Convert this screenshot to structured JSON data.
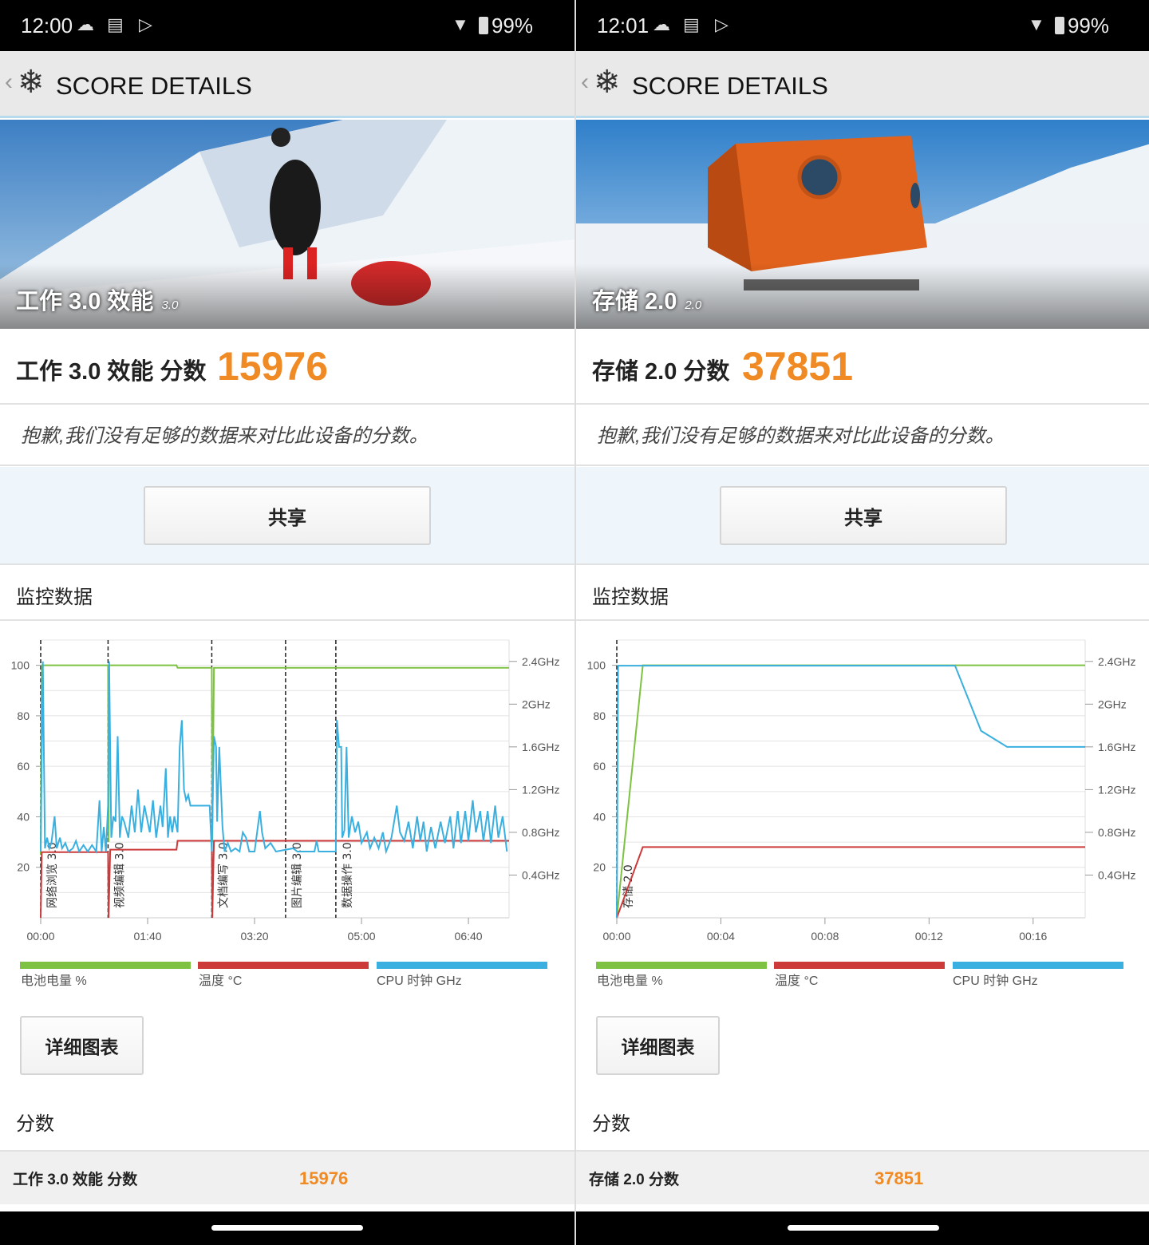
{
  "panels": [
    {
      "status": {
        "time": "12:00",
        "battery": "99%"
      },
      "header": {
        "title": "SCORE DETAILS"
      },
      "hero": {
        "caption": "工作 3.0 效能",
        "version": "3.0"
      },
      "score": {
        "label": "工作 3.0 效能 分数",
        "value": "15976"
      },
      "apology": "抱歉,我们没有足够的数据来对比此设备的分数。",
      "share_label": "共享",
      "monitor_title": "监控数据",
      "legend": [
        "电池电量 %",
        "温度 °C",
        "CPU 时钟 GHz"
      ],
      "detail_label": "详细图表",
      "scores_heading": "分数",
      "score_row": {
        "label": "工作 3.0 效能 分数",
        "value": "15976"
      }
    },
    {
      "status": {
        "time": "12:01",
        "battery": "99%"
      },
      "header": {
        "title": "SCORE DETAILS"
      },
      "hero": {
        "caption": "存储 2.0",
        "version": "2.0"
      },
      "score": {
        "label": "存储 2.0 分数",
        "value": "37851"
      },
      "apology": "抱歉,我们没有足够的数据来对比此设备的分数。",
      "share_label": "共享",
      "monitor_title": "监控数据",
      "legend": [
        "电池电量 %",
        "温度 °C",
        "CPU 时钟 GHz"
      ],
      "detail_label": "详细图表",
      "scores_heading": "分数",
      "score_row": {
        "label": "存储 2.0 分数",
        "value": "37851"
      }
    }
  ],
  "colors": {
    "battery": "#7dc242",
    "temp": "#cc3a3a",
    "cpu": "#3ab0e0",
    "accent": "#f08a24"
  },
  "chart_data": [
    {
      "type": "line",
      "xlim": [
        0,
        438
      ],
      "ylim": [
        0,
        110
      ],
      "y2lim": [
        0,
        2.6
      ],
      "xticks": [
        [
          0,
          "00:00"
        ],
        [
          100,
          "01:40"
        ],
        [
          200,
          "03:20"
        ],
        [
          300,
          "05:00"
        ],
        [
          400,
          "06:40"
        ]
      ],
      "yticks": [
        20,
        40,
        60,
        80,
        100
      ],
      "y2ticks": [
        [
          0.4,
          "0.4GHz"
        ],
        [
          0.8,
          "0.8GHz"
        ],
        [
          1.2,
          "1.2GHz"
        ],
        [
          1.6,
          "1.6GHz"
        ],
        [
          2.0,
          "2GHz"
        ],
        [
          2.4,
          "2.4GHz"
        ]
      ],
      "markers": [
        [
          0,
          "网络浏览 3.0"
        ],
        [
          63,
          "视频编辑 3.0"
        ],
        [
          160,
          "文档编写 3.0"
        ],
        [
          229,
          "图片编辑 3.0"
        ],
        [
          276,
          "数据操作 3.0"
        ]
      ],
      "series": [
        {
          "name": "电池电量 %",
          "axis": "left",
          "color": "#7dc242",
          "points": [
            [
              0,
              25
            ],
            [
              1,
              100
            ],
            [
              63,
              100
            ],
            [
              63.5,
              30
            ],
            [
              64,
              100
            ],
            [
              127,
              100
            ],
            [
              128,
              99
            ],
            [
              160,
              99
            ],
            [
              160.5,
              30
            ],
            [
              162,
              99
            ],
            [
              438,
              99
            ]
          ]
        },
        {
          "name": "温度 °C",
          "axis": "left",
          "color": "#cc3a3a",
          "points": [
            [
              0,
              0
            ],
            [
              1,
              26
            ],
            [
              63,
              26
            ],
            [
              63.5,
              0
            ],
            [
              65,
              27
            ],
            [
              127,
              27
            ],
            [
              128,
              30.5
            ],
            [
              160,
              30.5
            ],
            [
              160.5,
              0
            ],
            [
              162,
              30.5
            ],
            [
              438,
              30.5
            ]
          ]
        },
        {
          "name": "CPU 时钟 GHz",
          "axis": "right",
          "color": "#3ab0e0",
          "points": [
            [
              0,
              0.62
            ],
            [
              2,
              2.4
            ],
            [
              4,
              0.65
            ],
            [
              6,
              0.75
            ],
            [
              8,
              0.65
            ],
            [
              10,
              0.7
            ],
            [
              13,
              0.95
            ],
            [
              15,
              0.65
            ],
            [
              18,
              0.75
            ],
            [
              20,
              0.65
            ],
            [
              23,
              0.7
            ],
            [
              26,
              0.62
            ],
            [
              30,
              0.65
            ],
            [
              33,
              0.72
            ],
            [
              36,
              0.62
            ],
            [
              40,
              0.68
            ],
            [
              44,
              0.62
            ],
            [
              48,
              0.68
            ],
            [
              52,
              0.62
            ],
            [
              55,
              1.1
            ],
            [
              57,
              0.62
            ],
            [
              59,
              0.85
            ],
            [
              61,
              0.62
            ],
            [
              63,
              1.05
            ],
            [
              64,
              2.4
            ],
            [
              66,
              0.75
            ],
            [
              68,
              0.95
            ],
            [
              70,
              0.9
            ],
            [
              72,
              1.7
            ],
            [
              74,
              0.75
            ],
            [
              76,
              0.95
            ],
            [
              78,
              0.9
            ],
            [
              82,
              0.75
            ],
            [
              85,
              1.05
            ],
            [
              88,
              0.8
            ],
            [
              91,
              1.2
            ],
            [
              94,
              0.8
            ],
            [
              97,
              1.05
            ],
            [
              99,
              0.95
            ],
            [
              102,
              0.8
            ],
            [
              105,
              1.1
            ],
            [
              108,
              0.75
            ],
            [
              112,
              1.05
            ],
            [
              114,
              0.85
            ],
            [
              117,
              1.4
            ],
            [
              119,
              0.75
            ],
            [
              121,
              0.95
            ],
            [
              123,
              0.8
            ],
            [
              125,
              0.95
            ],
            [
              128,
              0.8
            ],
            [
              130,
              1.6
            ],
            [
              132,
              1.85
            ],
            [
              134,
              1.2
            ],
            [
              136,
              1.1
            ],
            [
              138,
              1.15
            ],
            [
              140,
              1.05
            ],
            [
              146,
              1.05
            ],
            [
              158,
              1.05
            ],
            [
              160,
              0.62
            ],
            [
              162,
              1.7
            ],
            [
              164,
              1.6
            ],
            [
              165,
              0.9
            ],
            [
              167,
              1.6
            ],
            [
              170,
              0.85
            ],
            [
              172,
              0.62
            ],
            [
              175,
              0.7
            ],
            [
              178,
              0.62
            ],
            [
              182,
              0.65
            ],
            [
              186,
              0.62
            ],
            [
              189,
              0.8
            ],
            [
              192,
              0.75
            ],
            [
              195,
              0.62
            ],
            [
              200,
              0.62
            ],
            [
              205,
              1.0
            ],
            [
              207,
              0.8
            ],
            [
              210,
              0.65
            ],
            [
              215,
              0.7
            ],
            [
              220,
              0.62
            ],
            [
              236,
              0.65
            ],
            [
              240,
              0.62
            ],
            [
              256,
              0.62
            ],
            [
              258,
              0.72
            ],
            [
              260,
              0.62
            ],
            [
              276,
              0.62
            ],
            [
              277,
              1.85
            ],
            [
              279,
              1.6
            ],
            [
              281,
              1.6
            ],
            [
              282,
              0.75
            ],
            [
              284,
              0.82
            ],
            [
              286,
              1.6
            ],
            [
              288,
              0.75
            ],
            [
              291,
              0.95
            ],
            [
              294,
              0.8
            ],
            [
              297,
              0.9
            ],
            [
              300,
              0.7
            ],
            [
              305,
              0.8
            ],
            [
              308,
              0.65
            ],
            [
              312,
              0.75
            ],
            [
              316,
              0.65
            ],
            [
              320,
              0.8
            ],
            [
              323,
              0.62
            ],
            [
              328,
              0.75
            ],
            [
              333,
              1.05
            ],
            [
              336,
              0.8
            ],
            [
              340,
              0.72
            ],
            [
              344,
              0.9
            ],
            [
              348,
              0.65
            ],
            [
              352,
              0.95
            ],
            [
              355,
              0.72
            ],
            [
              358,
              0.9
            ],
            [
              361,
              0.62
            ],
            [
              365,
              0.85
            ],
            [
              369,
              0.65
            ],
            [
              374,
              0.9
            ],
            [
              378,
              0.7
            ],
            [
              383,
              0.95
            ],
            [
              386,
              0.65
            ],
            [
              390,
              1.0
            ],
            [
              393,
              0.7
            ],
            [
              397,
              1.0
            ],
            [
              400,
              0.72
            ],
            [
              404,
              1.1
            ],
            [
              407,
              0.8
            ],
            [
              411,
              1.0
            ],
            [
              414,
              0.72
            ],
            [
              418,
              1.0
            ],
            [
              421,
              0.7
            ],
            [
              425,
              1.05
            ],
            [
              428,
              0.75
            ],
            [
              432,
              0.95
            ],
            [
              436,
              0.62
            ]
          ]
        }
      ]
    },
    {
      "type": "line",
      "xlim": [
        0,
        18
      ],
      "ylim": [
        0,
        110
      ],
      "y2lim": [
        0,
        2.6
      ],
      "xticks": [
        [
          0,
          "00:00"
        ],
        [
          4,
          "00:04"
        ],
        [
          8,
          "00:08"
        ],
        [
          12,
          "00:12"
        ],
        [
          16,
          "00:16"
        ]
      ],
      "yticks": [
        20,
        40,
        60,
        80,
        100
      ],
      "y2ticks": [
        [
          0.4,
          "0.4GHz"
        ],
        [
          0.8,
          "0.8GHz"
        ],
        [
          1.2,
          "1.2GHz"
        ],
        [
          1.6,
          "1.6GHz"
        ],
        [
          2.0,
          "2GHz"
        ],
        [
          2.4,
          "2.4GHz"
        ]
      ],
      "markers": [
        [
          0,
          "存储 2.0"
        ]
      ],
      "series": [
        {
          "name": "电池电量 %",
          "axis": "left",
          "color": "#7dc242",
          "points": [
            [
              0,
              0
            ],
            [
              1,
              100
            ],
            [
              18,
              100
            ]
          ]
        },
        {
          "name": "温度 °C",
          "axis": "left",
          "color": "#cc3a3a",
          "points": [
            [
              0,
              0
            ],
            [
              1,
              28
            ],
            [
              18,
              28
            ]
          ]
        },
        {
          "name": "CPU 时钟 GHz",
          "axis": "right",
          "color": "#3ab0e0",
          "points": [
            [
              0,
              0
            ],
            [
              0.05,
              2.36
            ],
            [
              13,
              2.36
            ],
            [
              14,
              1.75
            ],
            [
              15,
              1.6
            ],
            [
              18,
              1.6
            ]
          ]
        }
      ]
    }
  ]
}
